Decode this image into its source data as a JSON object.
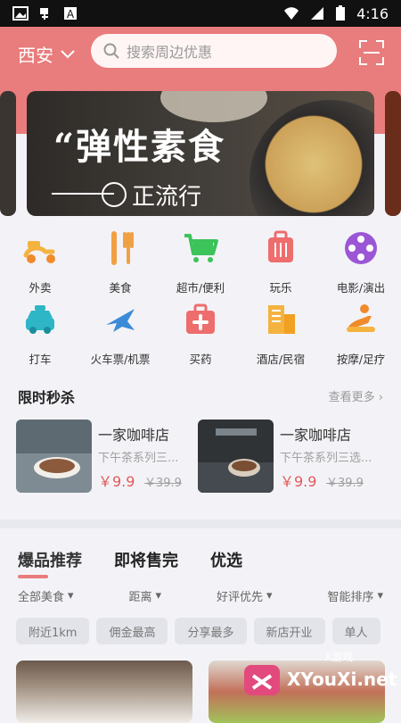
{
  "status": {
    "time": "4:16"
  },
  "header": {
    "city": "西安",
    "search_placeholder": "搜索周边优惠"
  },
  "banner": {
    "title": "“弹性素食",
    "subtitle": "正流行"
  },
  "icons": [
    {
      "label": "外卖",
      "icon": "scooter-icon"
    },
    {
      "label": "美食",
      "icon": "cutlery-icon"
    },
    {
      "label": "超市/便利",
      "icon": "cart-icon"
    },
    {
      "label": "玩乐",
      "icon": "luggage-icon"
    },
    {
      "label": "电影/演出",
      "icon": "film-reel-icon"
    },
    {
      "label": "打车",
      "icon": "taxi-icon"
    },
    {
      "label": "火车票/机票",
      "icon": "plane-icon"
    },
    {
      "label": "买药",
      "icon": "medicine-icon"
    },
    {
      "label": "酒店/民宿",
      "icon": "hotel-icon"
    },
    {
      "label": "按摩/足疗",
      "icon": "massage-icon"
    }
  ],
  "flash_sale": {
    "title": "限时秒杀",
    "see_more": "查看更多",
    "deals": [
      {
        "name": "一家咖啡店",
        "desc": "下午茶系列三...",
        "price": "￥9.9",
        "original": "￥39.9"
      },
      {
        "name": "一家咖啡店",
        "desc": "下午茶系列三选...",
        "price": "￥9.9",
        "original": "￥39.9"
      }
    ]
  },
  "recommend": {
    "tabs": [
      "爆品推荐",
      "即将售完",
      "优选"
    ],
    "filters": [
      "全部美食",
      "距离",
      "好评优先",
      "智能排序"
    ],
    "chips": [
      "附近1km",
      "佣金最高",
      "分享最多",
      "新店开业",
      "单人"
    ]
  },
  "watermark": {
    "top": "X游戏",
    "bottom": "XYouXi.net"
  }
}
